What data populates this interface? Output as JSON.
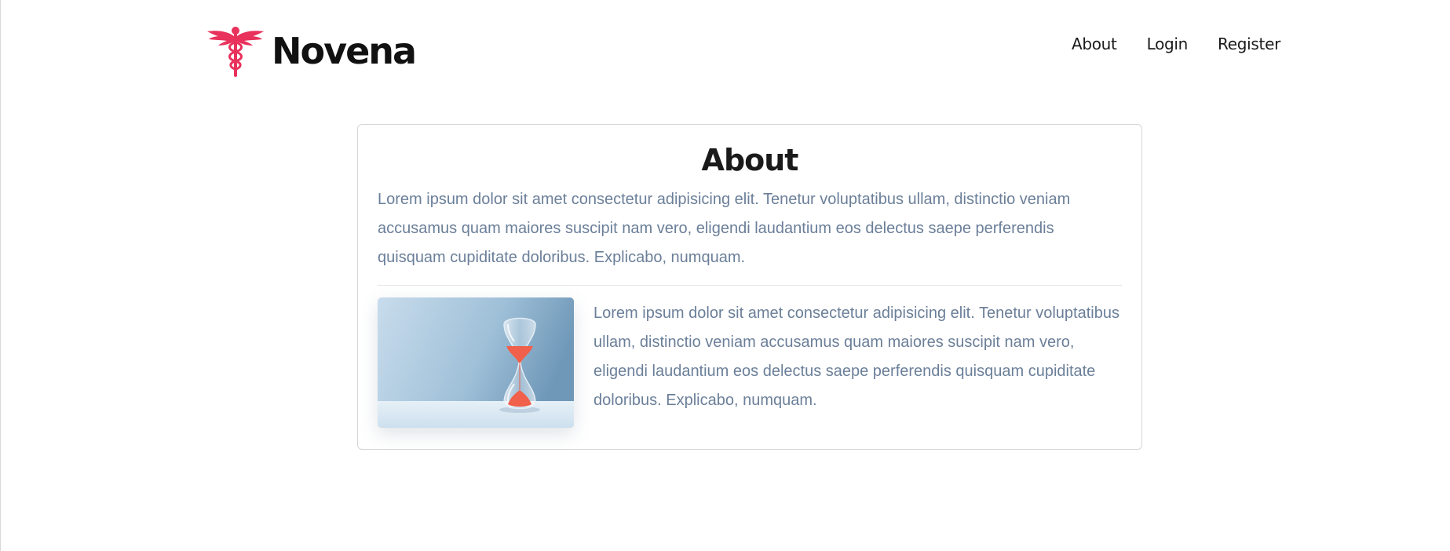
{
  "brand": {
    "name": "Novena",
    "accent": "#e8315b",
    "logo_icon": "caduceus-icon"
  },
  "nav": {
    "items": [
      {
        "label": "About"
      },
      {
        "label": "Login"
      },
      {
        "label": "Register"
      }
    ]
  },
  "about": {
    "title": "About",
    "lead": "Lorem ipsum dolor sit amet consectetur adipisicing elit. Tenetur voluptatibus ullam, distinctio veniam accusamus quam maiores suscipit nam vero, eligendi laudantium eos delectus saepe perferendis quisquam cupiditate doloribus. Explicabo, numquam.",
    "image": "hourglass-photo",
    "body": "Lorem ipsum dolor sit amet consectetur adipisicing elit. Tenetur voluptatibus ullam, distinctio veniam accusamus quam maiores suscipit nam vero, eligendi laudantium eos delectus saepe perferendis quisquam cupiditate doloribus. Explicabo, numquam."
  },
  "colors": {
    "text_muted": "#6b7f99",
    "heading": "#1a1a1a"
  }
}
